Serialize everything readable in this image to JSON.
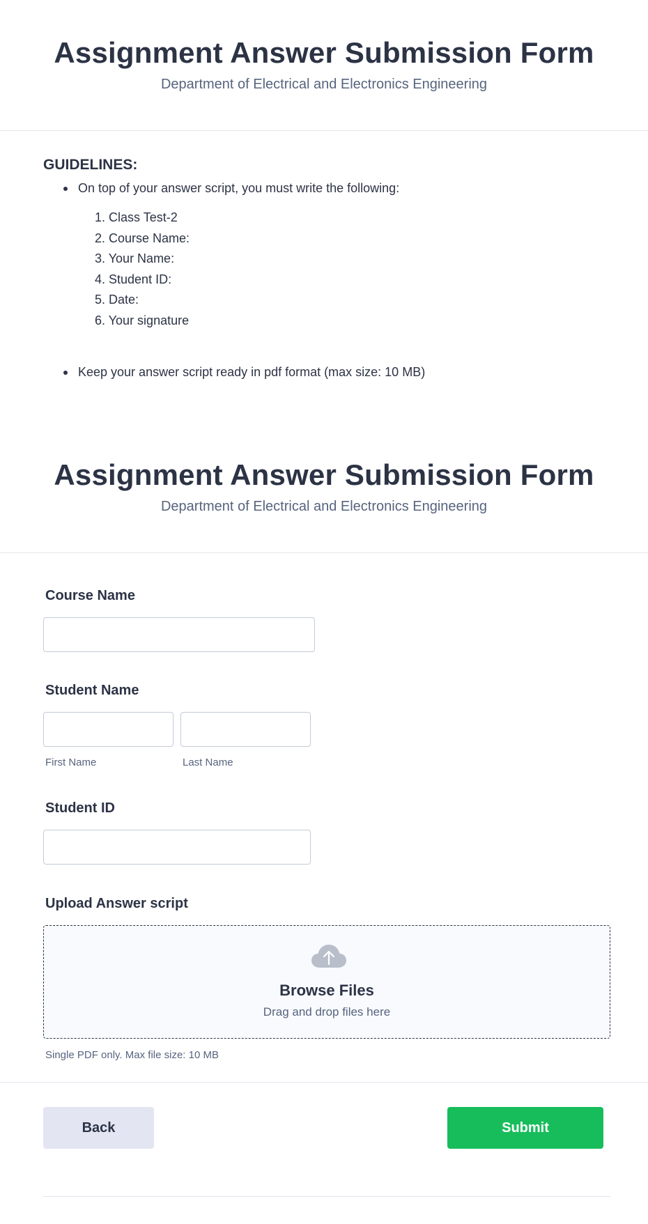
{
  "header": {
    "title": "Assignment Answer Submission Form",
    "subtitle": "Department of Electrical and Electronics Engineering"
  },
  "guidelines": {
    "title": "GUIDELINES:",
    "bullets": [
      "On top of your answer script, you must write the following:",
      "Keep your answer script ready in pdf format (max size: 10 MB)"
    ],
    "items": [
      "1. Class Test-2",
      "2. Course Name:",
      "3. Your Name:",
      "4. Student ID:",
      "5. Date:",
      "6. Your signature"
    ]
  },
  "form": {
    "course_name": {
      "label": "Course Name",
      "value": ""
    },
    "student_name": {
      "label": "Student Name",
      "first_label": "First Name",
      "last_label": "Last Name",
      "first_value": "",
      "last_value": ""
    },
    "student_id": {
      "label": "Student ID",
      "value": ""
    },
    "upload": {
      "label": "Upload Answer script",
      "browse": "Browse Files",
      "drag": "Drag and drop files here",
      "note": "Single PDF only. Max file size: 10 MB"
    }
  },
  "buttons": {
    "back": "Back",
    "submit": "Submit"
  },
  "colors": {
    "submit": "#18bd5b",
    "back": "#e3e5f2",
    "text": "#2c3345",
    "muted": "#57647e"
  },
  "icons": {
    "upload": "cloud-upload-icon"
  }
}
